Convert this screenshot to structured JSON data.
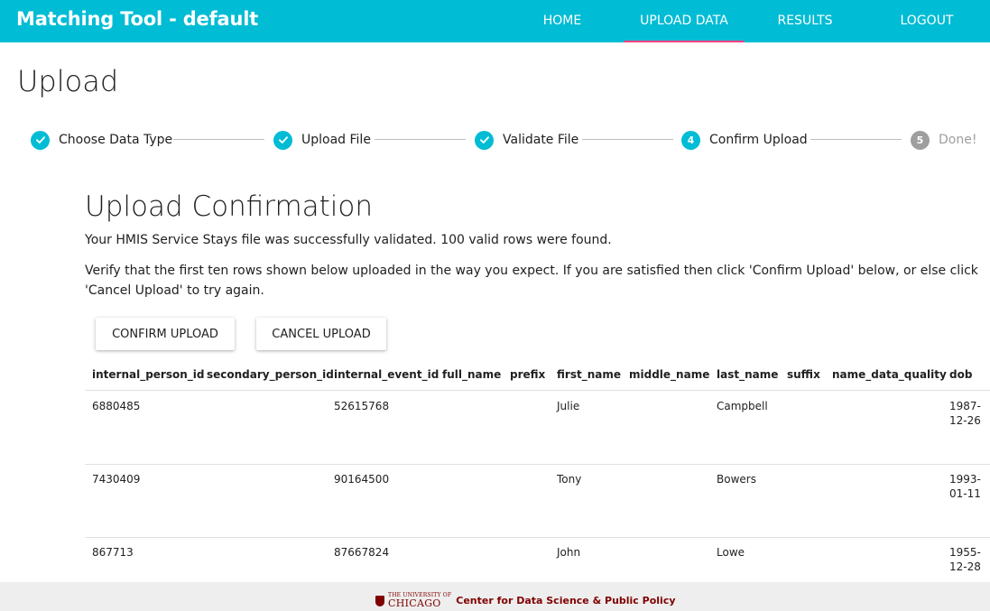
{
  "app": {
    "title": "Matching Tool - default",
    "accent_color": "#00bcd4",
    "active_indicator_color": "#ff4081"
  },
  "nav": {
    "items": [
      {
        "label": "HOME",
        "active": false
      },
      {
        "label": "UPLOAD DATA",
        "active": true
      },
      {
        "label": "RESULTS",
        "active": false
      },
      {
        "label": "LOGOUT",
        "active": false
      }
    ]
  },
  "page": {
    "title": "Upload"
  },
  "stepper": {
    "steps": [
      {
        "label": "Choose Data Type",
        "state": "complete",
        "icon": "check-circle-icon"
      },
      {
        "label": "Upload File",
        "state": "complete",
        "icon": "check-circle-icon"
      },
      {
        "label": "Validate File",
        "state": "complete",
        "icon": "check-circle-icon"
      },
      {
        "label": "Confirm Upload",
        "state": "active",
        "number": "4"
      },
      {
        "label": "Done!",
        "state": "todo",
        "number": "5"
      }
    ]
  },
  "confirmation": {
    "title": "Upload Confirmation",
    "message": "Your HMIS Service Stays file was successfully validated. 100 valid rows were found.",
    "instructions": "Verify that the first ten rows shown below uploaded in the way you expect. If you are satisfied then click 'Confirm Upload' below, or else click 'Cancel Upload' to try again.",
    "confirm_label": "CONFIRM UPLOAD",
    "cancel_label": "CANCEL UPLOAD"
  },
  "table": {
    "columns": [
      "internal_person_id",
      "secondary_person_id",
      "internal_event_id",
      "full_name",
      "prefix",
      "first_name",
      "middle_name",
      "last_name",
      "suffix",
      "name_data_quality",
      "dob"
    ],
    "rows": [
      [
        "6880485",
        "",
        "52615768",
        "",
        "",
        "Julie",
        "",
        "Campbell",
        "",
        "",
        "1987-12-26"
      ],
      [
        "7430409",
        "",
        "90164500",
        "",
        "",
        "Tony",
        "",
        "Bowers",
        "",
        "",
        "1993-01-11"
      ],
      [
        "867713",
        "",
        "87667824",
        "",
        "",
        "John",
        "",
        "Lowe",
        "",
        "",
        "1955-12-28"
      ]
    ]
  },
  "footer": {
    "univ_small": "THE UNIVERSITY OF",
    "univ_big": "CHICAGO",
    "text": "Center for Data Science & Public Policy"
  }
}
